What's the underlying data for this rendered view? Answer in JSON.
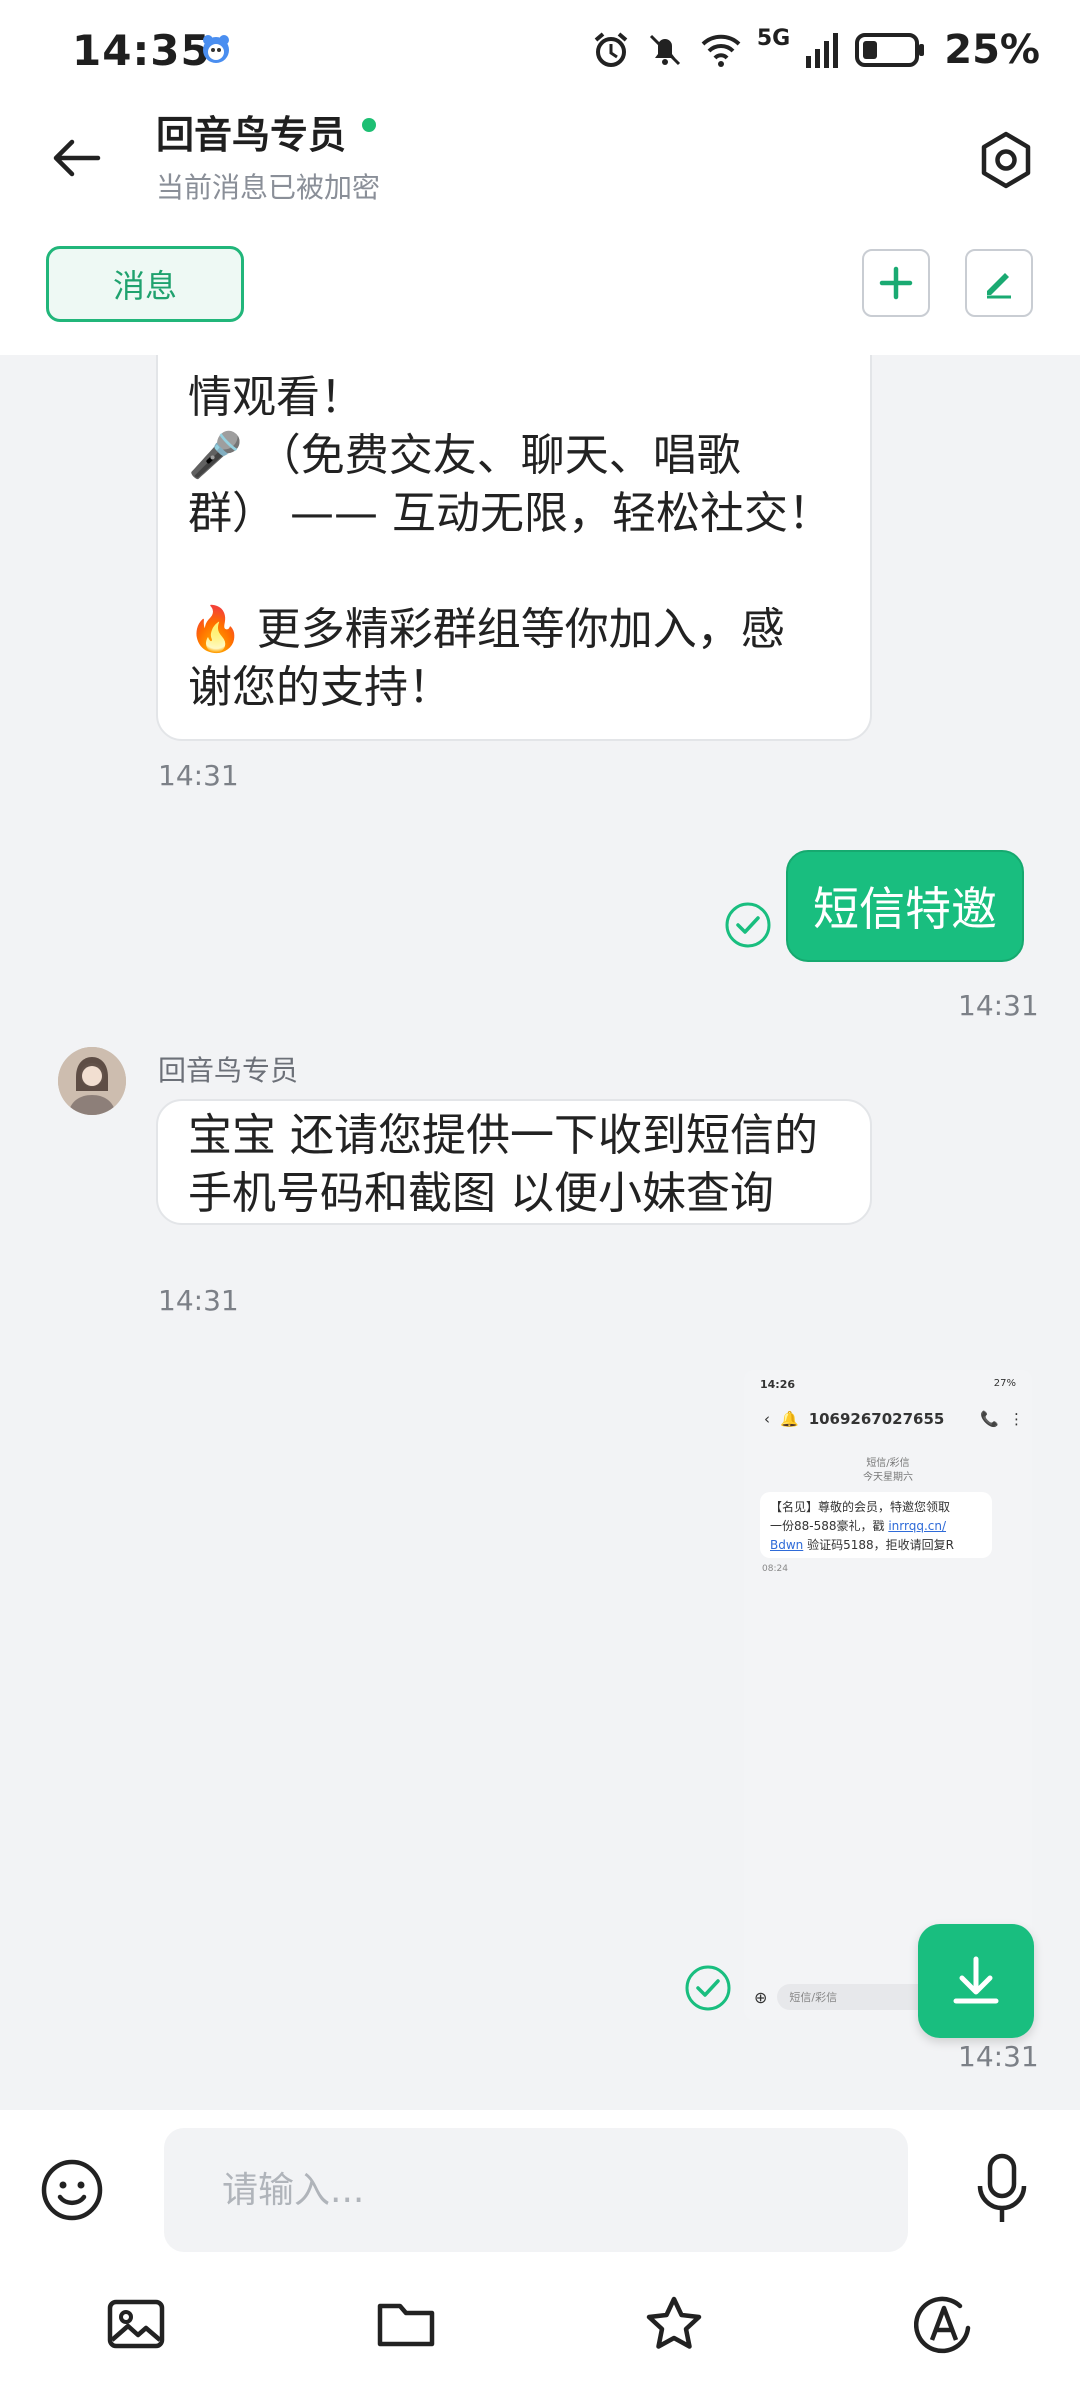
{
  "status_bar": {
    "time": "14:35",
    "network": "5G",
    "battery_percent": "25%"
  },
  "header": {
    "title": "回音鸟专员",
    "subtitle": "当前消息已被加密",
    "online_color": "#1dbf73"
  },
  "tabs": {
    "active_label": "消息"
  },
  "chat": {
    "messages": [
      {
        "lines": [
          "情观看！",
          "🎤 （免费交友、聊天、唱歌",
          "群） —— 互动无限，轻松社交！",
          "",
          "🔥 更多精彩群组等你加入，感",
          "谢您的支持！"
        ],
        "time": "14:31"
      },
      {
        "text": "短信特邀",
        "time": "14:31"
      },
      {
        "sender": "回音鸟专员",
        "lines": [
          "宝宝 还请您提供一下收到短信的",
          "手机号码和截图 以便小妹查询"
        ],
        "time": "14:31"
      },
      {
        "time": "14:31",
        "screenshot": {
          "status_time": "14:26",
          "status_right": "27%",
          "phone_number": "1069267027655",
          "date_label_1": "短信/彩信",
          "date_label_2": "今天星期六",
          "sms_line1": "【名见】尊敬的会员，特邀您领取",
          "sms_line2_pre": "一份88-588豪礼，戳 ",
          "sms_link_a": "inrrqq.cn/",
          "sms_link_b": "Bdwn",
          "sms_line3_post": " 验证码5188，拒收请回复R",
          "sms_time": "08:24",
          "input_placeholder": "短信/彩信"
        }
      }
    ]
  },
  "input_bar": {
    "placeholder": "请输入..."
  },
  "colors": {
    "accent": "#19be7f",
    "background": "#f2f3f5"
  }
}
